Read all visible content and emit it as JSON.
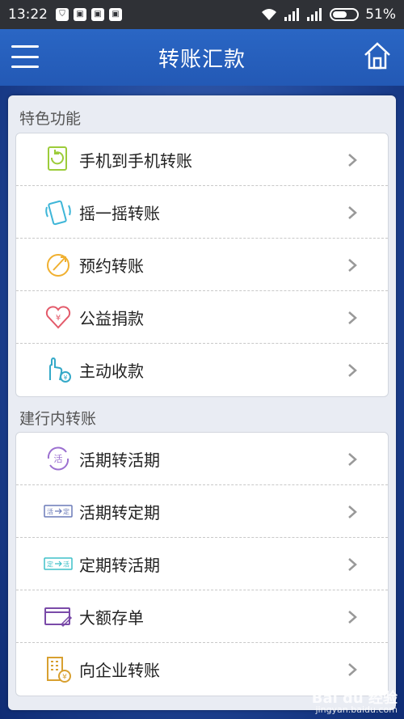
{
  "status_bar": {
    "time": "13:22",
    "battery": "51%",
    "notif_icons": [
      "shield-notif-icon",
      "app-notif-icon-1",
      "app-notif-icon-2",
      "app-notif-icon-3"
    ]
  },
  "header": {
    "title": "转账汇款"
  },
  "sections": [
    {
      "title": "特色功能",
      "items": [
        {
          "label": "手机到手机转账",
          "icon": "phone-transfer-icon"
        },
        {
          "label": "摇一摇转账",
          "icon": "shake-phone-icon"
        },
        {
          "label": "预约转账",
          "icon": "scheduled-transfer-icon"
        },
        {
          "label": "公益捐款",
          "icon": "charity-heart-icon"
        },
        {
          "label": "主动收款",
          "icon": "hand-payment-icon"
        }
      ]
    },
    {
      "title": "建行内转账",
      "items": [
        {
          "label": "活期转活期",
          "icon": "current-to-current-icon"
        },
        {
          "label": "活期转定期",
          "icon": "current-to-fixed-icon"
        },
        {
          "label": "定期转活期",
          "icon": "fixed-to-current-icon"
        },
        {
          "label": "大额存单",
          "icon": "certificate-deposit-icon"
        },
        {
          "label": "向企业转账",
          "icon": "enterprise-transfer-icon"
        }
      ]
    }
  ],
  "icon_glyphs": {
    "current": "活",
    "fixed": "定",
    "yuan": "¥"
  },
  "watermark": {
    "brand": "Bai du 经验",
    "url": "jingyan.baidu.com"
  },
  "colors": {
    "header": "#2a66c4",
    "background": "#1b3f8f",
    "panel": "#e9ecf3"
  }
}
